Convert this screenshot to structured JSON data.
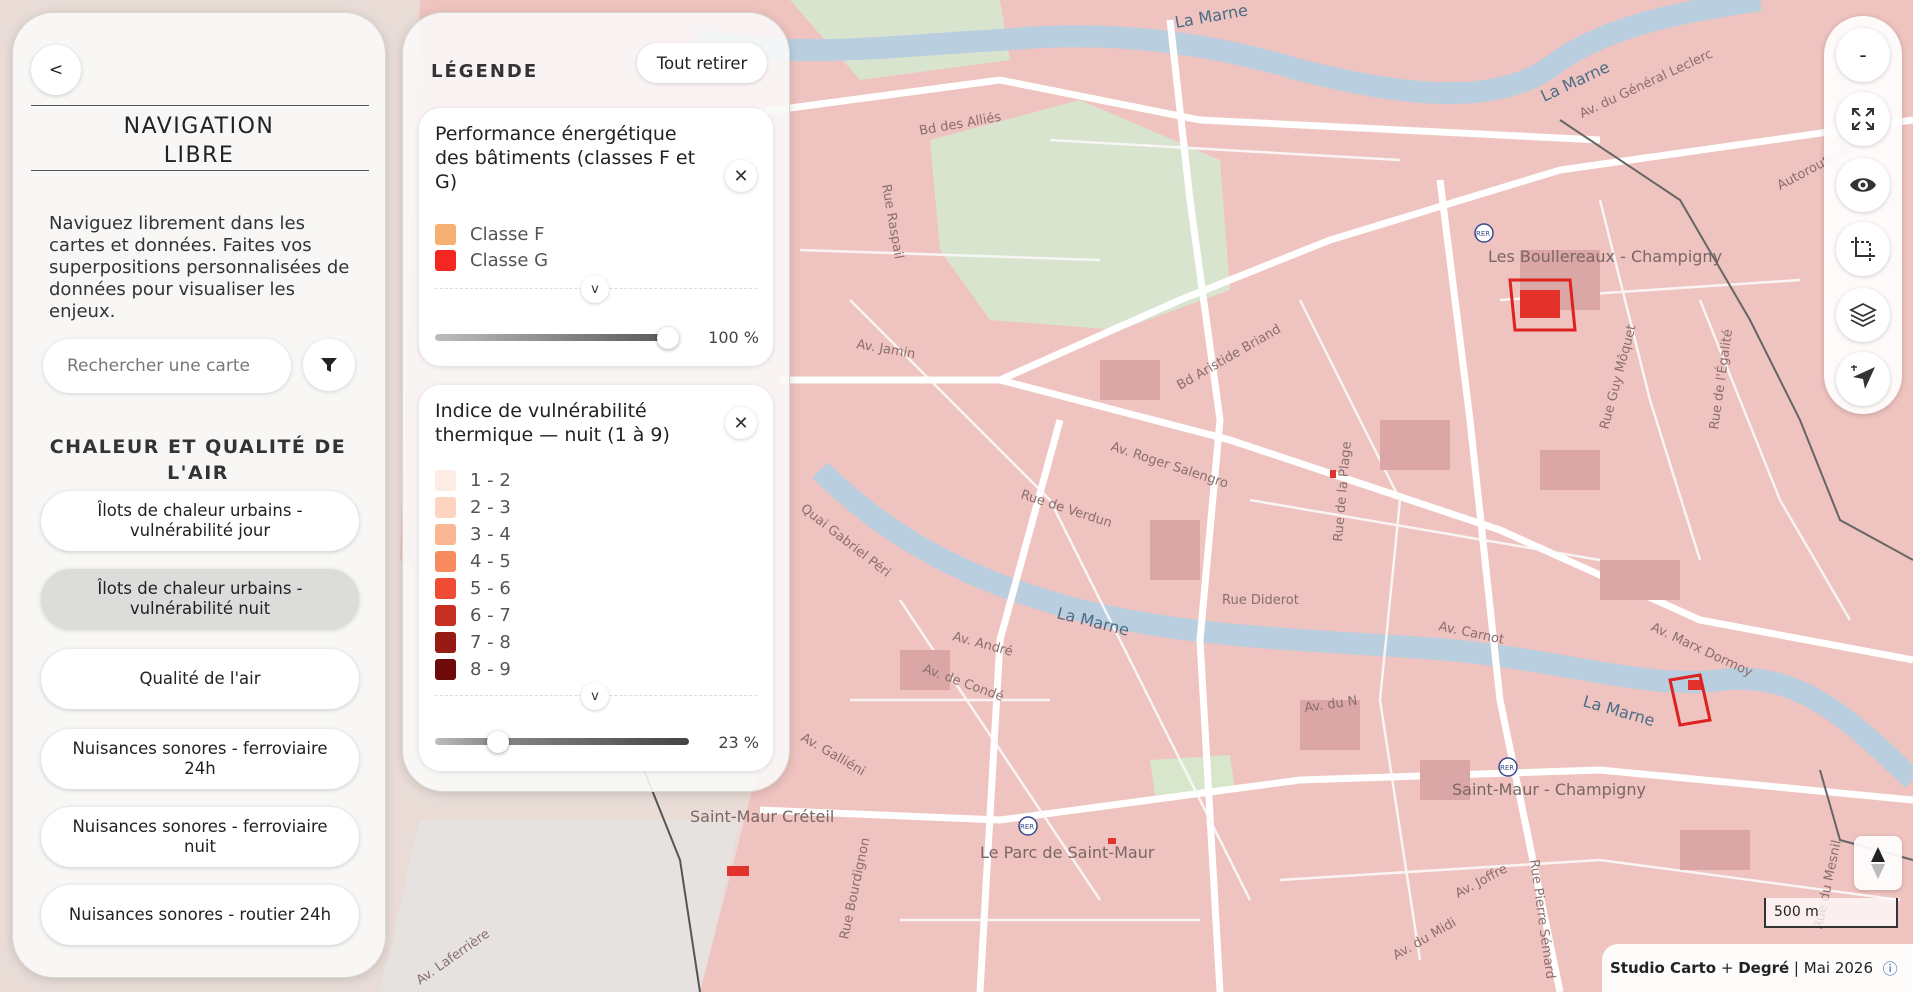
{
  "nav": {
    "back_label": "<",
    "title": "NAVIGATION LIBRE",
    "intro": "Naviguez librement dans les cartes et données. Faites vos superpositions personnalisées de données pour visualiser les enjeux.",
    "search_placeholder": "Rechercher une carte",
    "section_title": "CHALEUR ET QUALITÉ DE L'AIR",
    "items": [
      {
        "label": "Îlots de chaleur urbains - vulnérabilité jour",
        "active": false
      },
      {
        "label": "Îlots de chaleur urbains - vulnérabilité nuit",
        "active": true
      },
      {
        "label": "Qualité de l'air",
        "active": false
      },
      {
        "label": "Nuisances sonores - ferroviaire 24h",
        "active": false
      },
      {
        "label": "Nuisances sonores - ferroviaire nuit",
        "active": false
      },
      {
        "label": "Nuisances sonores - routier 24h",
        "active": false
      }
    ]
  },
  "legend": {
    "title": "LÉGENDE",
    "clear_label": "Tout retirer",
    "layers": [
      {
        "title": "Performance énergétique des bâtiments (classes F et G)",
        "items": [
          {
            "label": "Classe F",
            "color": "#f6b071"
          },
          {
            "label": "Classe G",
            "color": "#f52522"
          }
        ],
        "opacity": "100 %",
        "opacity_value": 100
      },
      {
        "title": "Indice de vulnérabilité thermique — nuit (1 à 9)",
        "items": [
          {
            "label": "1 - 2",
            "color": "#fdece4"
          },
          {
            "label": "2 - 3",
            "color": "#fcd4bf"
          },
          {
            "label": "3 - 4",
            "color": "#fbb793"
          },
          {
            "label": "4 - 5",
            "color": "#f78a5e"
          },
          {
            "label": "5 - 6",
            "color": "#ef4b35"
          },
          {
            "label": "6 - 7",
            "color": "#c52f22"
          },
          {
            "label": "7 - 8",
            "color": "#981b13"
          },
          {
            "label": "8 - 9",
            "color": "#6e0a0a"
          }
        ],
        "opacity": "23 %",
        "opacity_value": 23
      }
    ]
  },
  "map": {
    "place_labels": [
      "Les Boullereaux - Champigny",
      "Saint-Maur - Champigny",
      "Saint-Maur Créteil",
      "Le Parc de Saint-Maur"
    ],
    "street_labels": [
      "Av. Roger Salengro",
      "Bd Aristide Briand",
      "Rue de Verdun",
      "Rue Diderot",
      "Av. Carnot",
      "Av. Marx Dormoy",
      "Av. de Condé",
      "Av. André",
      "Av. Jamin",
      "Quai Gabriel Péri",
      "Bd des Alliés",
      "Rue Raspail",
      "Av. du Général Leclerc",
      "Autoroute de l'Est",
      "Rue de la Plage",
      "Rue Guy Môquet",
      "Rue de l'Égalité",
      "Av. Joffre",
      "Av. du Midi",
      "Rue Pierre Sémard",
      "Av. Galliéni",
      "Rue Bourdignon",
      "Av. Laferrière",
      "Av. du N",
      "Rue du Mesnil"
    ],
    "river_label": "La Marne",
    "rer_badge": "RER",
    "scale_label": "500 m",
    "colors": {
      "base": "#efc3bf",
      "river": "#b9cfdf",
      "park": "#d9e4cf",
      "road": "#ffffff"
    }
  },
  "toolbar": {
    "zoom_out": "-",
    "icons": [
      "fullscreen-icon",
      "eye-icon",
      "crop-select-icon",
      "layers-icon",
      "locate-icon"
    ]
  },
  "credits": {
    "brand1": "Studio Carto",
    "plus": "+",
    "brand2": "Degré",
    "sep": "|",
    "date": "Mai 2026",
    "info": "ⓘ"
  }
}
